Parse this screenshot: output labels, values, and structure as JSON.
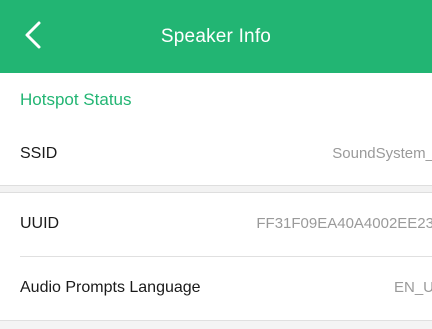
{
  "header": {
    "title": "Speaker Info",
    "back_icon": "chevron-left-icon",
    "background_color": "#22b573"
  },
  "section": {
    "title": "Hotspot Status",
    "color": "#22b573"
  },
  "rows": [
    {
      "label": "SSID",
      "value": "SoundSystem_"
    },
    {
      "label": "UUID",
      "value": "FF31F09EA40A4002EE23"
    },
    {
      "label": "Audio Prompts Language",
      "value": "EN_U"
    }
  ]
}
